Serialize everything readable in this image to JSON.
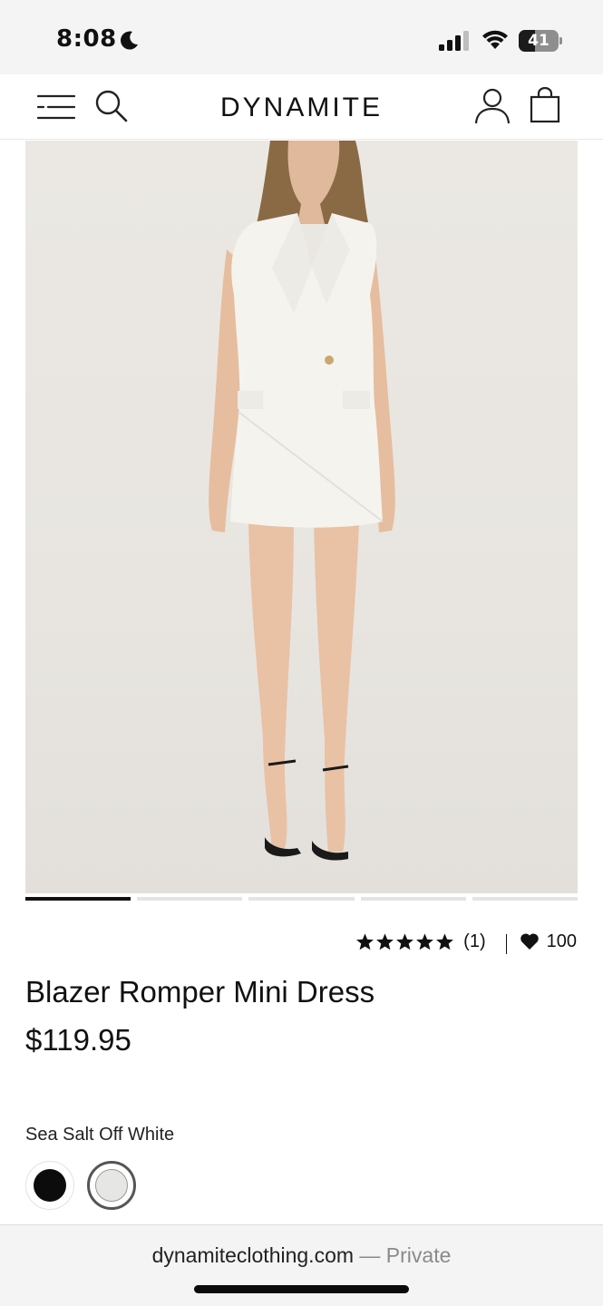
{
  "status_bar": {
    "time": "8:08",
    "battery": "41",
    "battery_level": 0.41
  },
  "header": {
    "brand": "DYNAMITE"
  },
  "product": {
    "image_count": 5,
    "active_image_index": 0,
    "rating": 5,
    "review_count": "(1)",
    "likes": "100",
    "title": "Blazer Romper Mini Dress",
    "price": "$119.95",
    "color_name": "Sea Salt Off White",
    "swatches": [
      {
        "name": "black",
        "color": "#0c0c0c",
        "selected": false
      },
      {
        "name": "sea-salt-off-white",
        "color": "#e6e6e4",
        "selected": true
      }
    ]
  },
  "browser": {
    "domain": "dynamiteclothing.com",
    "private_label": " — Private"
  }
}
